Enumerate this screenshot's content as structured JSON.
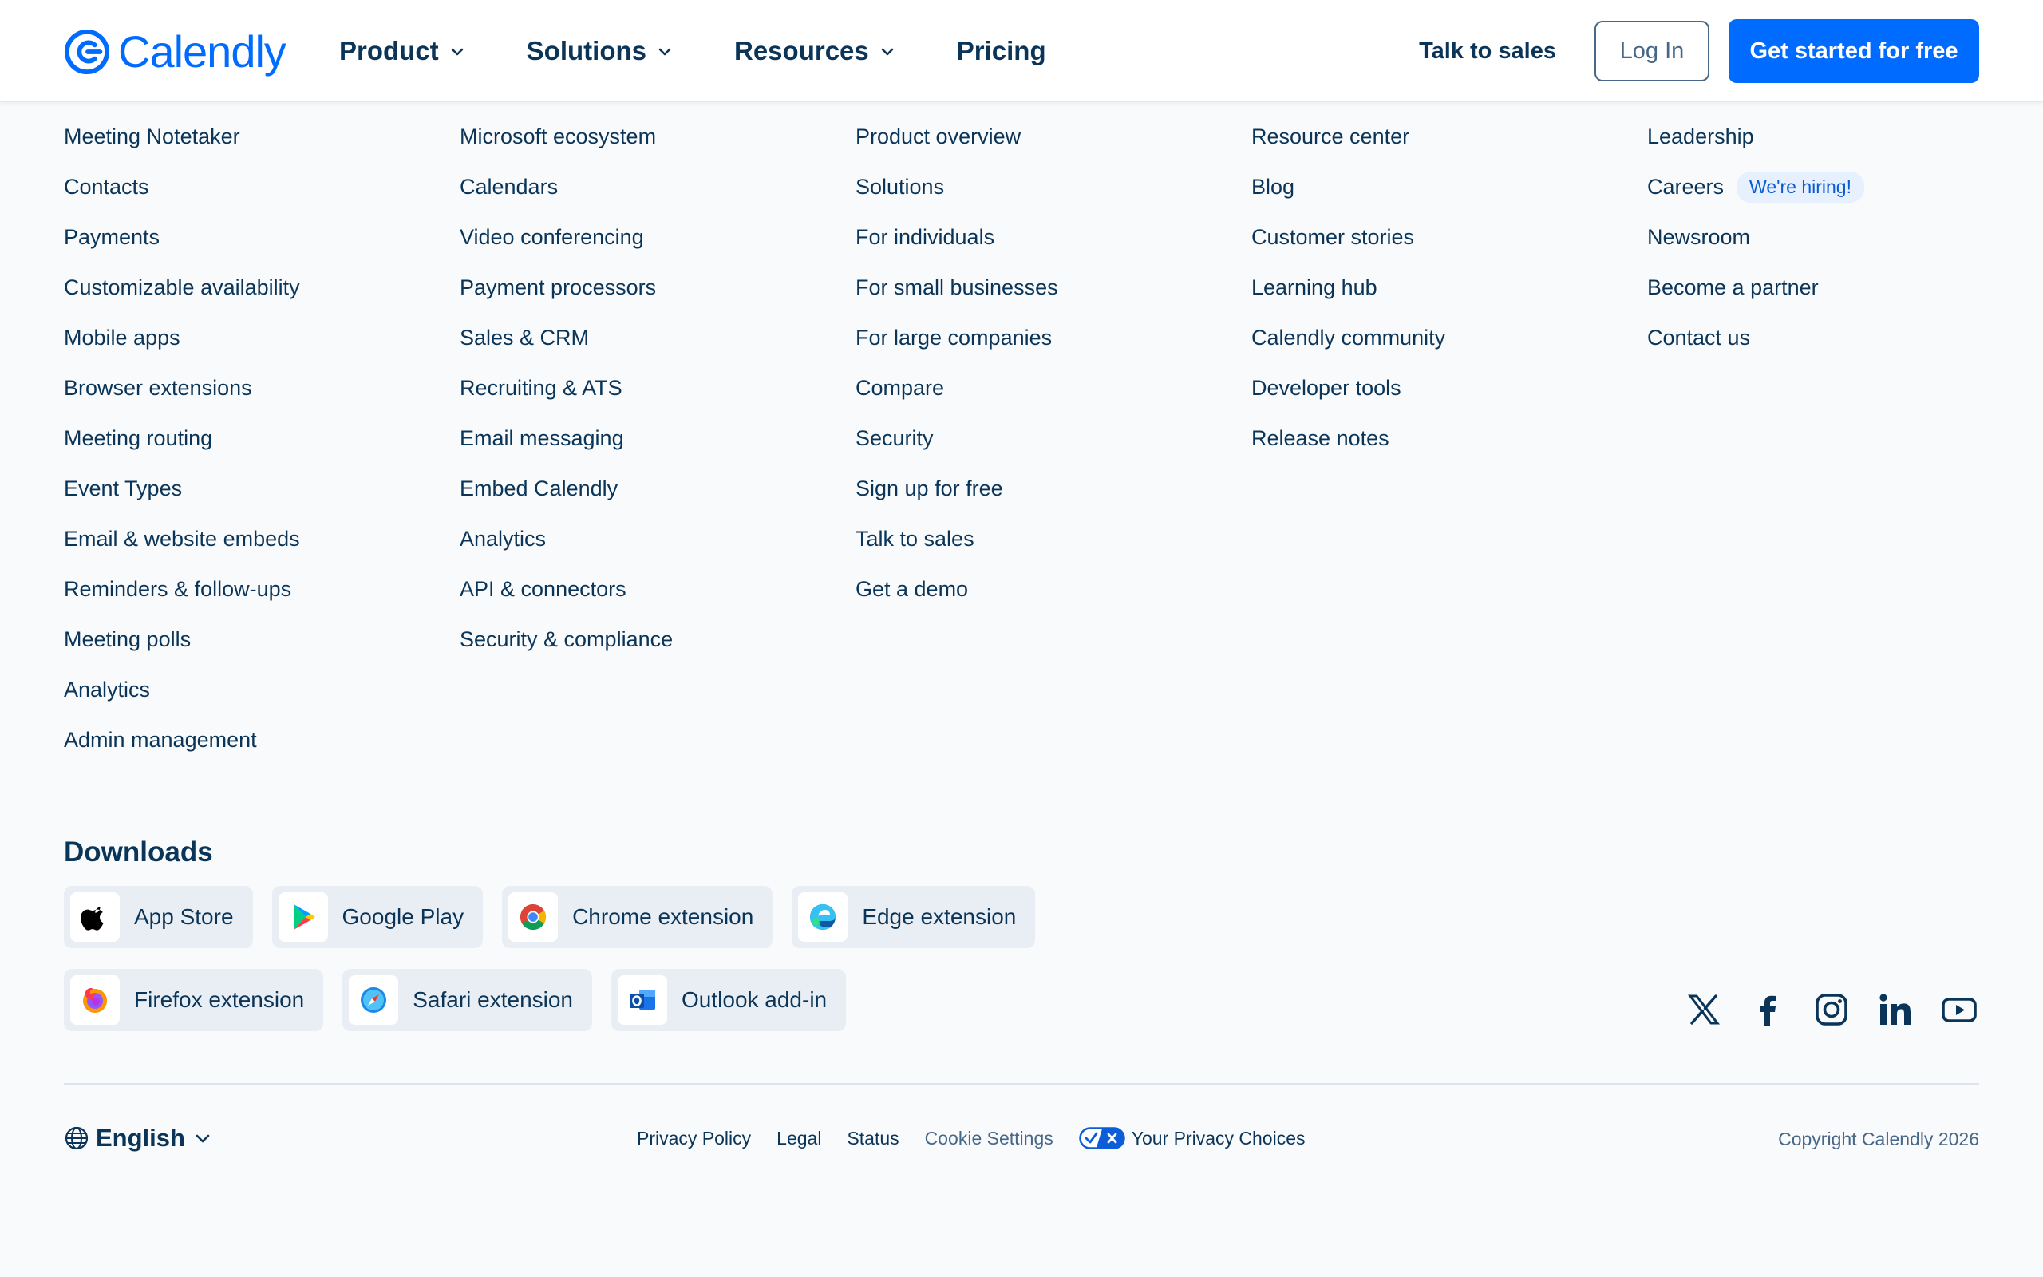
{
  "brand": {
    "name": "Calendly",
    "color": "#006bff"
  },
  "header": {
    "nav": [
      {
        "label": "Product",
        "has_menu": true
      },
      {
        "label": "Solutions",
        "has_menu": true
      },
      {
        "label": "Resources",
        "has_menu": true
      },
      {
        "label": "Pricing",
        "has_menu": false
      }
    ],
    "talk_to_sales": "Talk to sales",
    "login": "Log In",
    "cta": "Get started for free"
  },
  "columns": [
    {
      "links": [
        "Meeting Notetaker",
        "Contacts",
        "Payments",
        "Customizable availability",
        "Mobile apps",
        "Browser extensions",
        "Meeting routing",
        "Event Types",
        "Email & website embeds",
        "Reminders & follow-ups",
        "Meeting polls",
        "Analytics",
        "Admin management"
      ]
    },
    {
      "links": [
        "Microsoft ecosystem",
        "Calendars",
        "Video conferencing",
        "Payment processors",
        "Sales & CRM",
        "Recruiting & ATS",
        "Email messaging",
        "Embed Calendly",
        "Analytics",
        "API & connectors",
        "Security & compliance"
      ]
    },
    {
      "links": [
        "Product overview",
        "Solutions",
        "For individuals",
        "For small businesses",
        "For large companies",
        "Compare",
        "Security",
        "Sign up for free",
        "Talk to sales",
        "Get a demo"
      ]
    },
    {
      "links": [
        "Resource center",
        "Blog",
        "Customer stories",
        "Learning hub",
        "Calendly community",
        "Developer tools",
        "Release notes"
      ]
    },
    {
      "links": [
        "Leadership",
        "Careers",
        "Newsroom",
        "Become a partner",
        "Contact us"
      ],
      "badge": {
        "index": 1,
        "label": "We're hiring!"
      }
    }
  ],
  "downloads": {
    "title": "Downloads",
    "row1": [
      {
        "label": "App Store",
        "icon": "apple-icon"
      },
      {
        "label": "Google Play",
        "icon": "google-play-icon"
      },
      {
        "label": "Chrome extension",
        "icon": "chrome-icon"
      },
      {
        "label": "Edge extension",
        "icon": "edge-icon"
      }
    ],
    "row2": [
      {
        "label": "Firefox extension",
        "icon": "firefox-icon"
      },
      {
        "label": "Safari extension",
        "icon": "safari-icon"
      },
      {
        "label": "Outlook add-in",
        "icon": "outlook-icon"
      }
    ]
  },
  "social": [
    "x-icon",
    "facebook-icon",
    "instagram-icon",
    "linkedin-icon",
    "youtube-icon"
  ],
  "footer": {
    "language": "English",
    "links": [
      {
        "label": "Privacy Policy",
        "muted": false
      },
      {
        "label": "Legal",
        "muted": false
      },
      {
        "label": "Status",
        "muted": false
      },
      {
        "label": "Cookie Settings",
        "muted": true
      }
    ],
    "privacy_choices": "Your Privacy Choices",
    "copyright": "Copyright Calendly 2026"
  }
}
